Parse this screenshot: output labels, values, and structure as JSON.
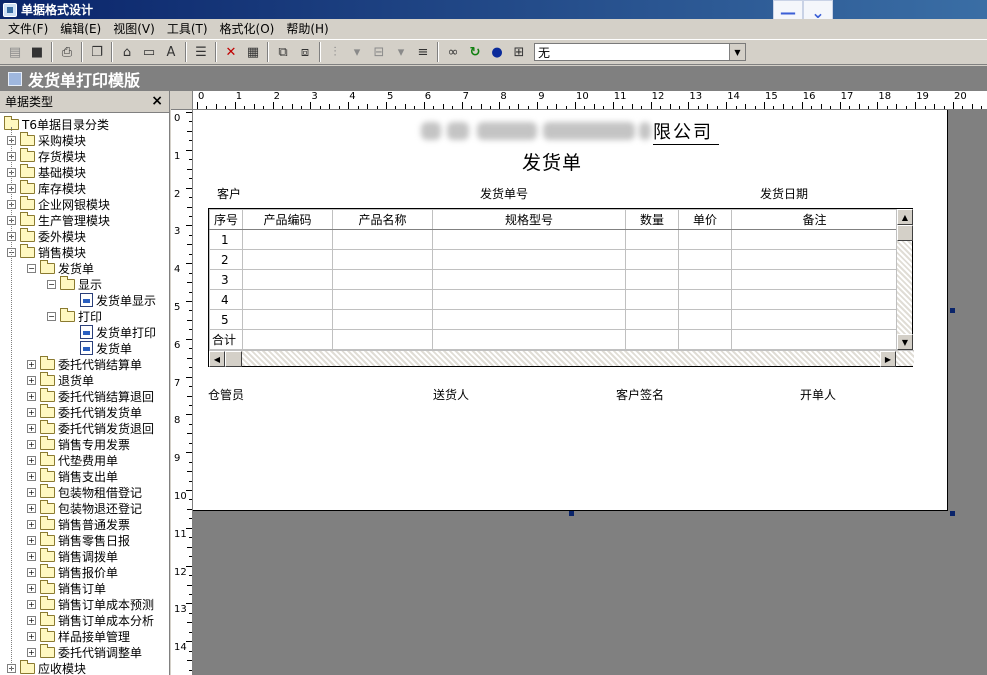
{
  "window": {
    "title": "单据格式设计"
  },
  "window_buttons": {
    "minimize": "—",
    "dropdown": "⌄"
  },
  "menu": [
    {
      "label": "文件(F)"
    },
    {
      "label": "编辑(E)"
    },
    {
      "label": "视图(V)"
    },
    {
      "label": "工具(T)"
    },
    {
      "label": "格式化(O)"
    },
    {
      "label": "帮助(H)"
    }
  ],
  "toolbar": {
    "font_glyph": "A",
    "style_combo_value": "无"
  },
  "document": {
    "title": "发货单打印模版"
  },
  "left_panel": {
    "title": "单据类型",
    "close_label": "×"
  },
  "tree": [
    {
      "label": "T6单据目录分类",
      "level": 0,
      "kind": "root"
    },
    {
      "label": "采购模块",
      "level": 1,
      "kind": "folder",
      "toggle": "+"
    },
    {
      "label": "存货模块",
      "level": 1,
      "kind": "folder",
      "toggle": "+"
    },
    {
      "label": "基础模块",
      "level": 1,
      "kind": "folder",
      "toggle": "+"
    },
    {
      "label": "库存模块",
      "level": 1,
      "kind": "folder",
      "toggle": "+"
    },
    {
      "label": "企业网银模块",
      "level": 1,
      "kind": "folder",
      "toggle": "+"
    },
    {
      "label": "生产管理模块",
      "level": 1,
      "kind": "folder",
      "toggle": "+"
    },
    {
      "label": "委外模块",
      "level": 1,
      "kind": "folder",
      "toggle": "+"
    },
    {
      "label": "销售模块",
      "level": 1,
      "kind": "folder",
      "toggle": "−"
    },
    {
      "label": "发货单",
      "level": 2,
      "kind": "folder",
      "toggle": "−"
    },
    {
      "label": "显示",
      "level": 3,
      "kind": "folder",
      "toggle": "−"
    },
    {
      "label": "发货单显示",
      "level": 4,
      "kind": "doc"
    },
    {
      "label": "打印",
      "level": 3,
      "kind": "folder",
      "toggle": "−"
    },
    {
      "label": "发货单打印",
      "level": 4,
      "kind": "doc"
    },
    {
      "label": "发货单",
      "level": 4,
      "kind": "doc"
    },
    {
      "label": "委托代销结算单",
      "level": 2,
      "kind": "folder",
      "toggle": "+"
    },
    {
      "label": "退货单",
      "level": 2,
      "kind": "folder",
      "toggle": "+"
    },
    {
      "label": "委托代销结算退回",
      "level": 2,
      "kind": "folder",
      "toggle": "+"
    },
    {
      "label": "委托代销发货单",
      "level": 2,
      "kind": "folder",
      "toggle": "+"
    },
    {
      "label": "委托代销发货退回",
      "level": 2,
      "kind": "folder",
      "toggle": "+"
    },
    {
      "label": "销售专用发票",
      "level": 2,
      "kind": "folder",
      "toggle": "+"
    },
    {
      "label": "代垫费用单",
      "level": 2,
      "kind": "folder",
      "toggle": "+"
    },
    {
      "label": "销售支出单",
      "level": 2,
      "kind": "folder",
      "toggle": "+"
    },
    {
      "label": "包装物租借登记",
      "level": 2,
      "kind": "folder",
      "toggle": "+"
    },
    {
      "label": "包装物退还登记",
      "level": 2,
      "kind": "folder",
      "toggle": "+"
    },
    {
      "label": "销售普通发票",
      "level": 2,
      "kind": "folder",
      "toggle": "+"
    },
    {
      "label": "销售零售日报",
      "level": 2,
      "kind": "folder",
      "toggle": "+"
    },
    {
      "label": "销售调拨单",
      "level": 2,
      "kind": "folder",
      "toggle": "+"
    },
    {
      "label": "销售报价单",
      "level": 2,
      "kind": "folder",
      "toggle": "+"
    },
    {
      "label": "销售订单",
      "level": 2,
      "kind": "folder",
      "toggle": "+"
    },
    {
      "label": "销售订单成本预测",
      "level": 2,
      "kind": "folder",
      "toggle": "+"
    },
    {
      "label": "销售订单成本分析",
      "level": 2,
      "kind": "folder",
      "toggle": "+"
    },
    {
      "label": "样品接单管理",
      "level": 2,
      "kind": "folder",
      "toggle": "+"
    },
    {
      "label": "委托代销调整单",
      "level": 2,
      "kind": "folder",
      "toggle": "+"
    },
    {
      "label": "应收模块",
      "level": 1,
      "kind": "folder",
      "toggle": "+"
    }
  ],
  "ruler_top": [
    "0",
    "1",
    "2",
    "3",
    "4",
    "5",
    "6",
    "7",
    "8",
    "9",
    "10",
    "11",
    "12",
    "13",
    "14",
    "15",
    "16",
    "17",
    "18",
    "19",
    "20"
  ],
  "ruler_left": [
    "0",
    "1",
    "2",
    "3",
    "4",
    "5",
    "6",
    "7",
    "8",
    "9",
    "10",
    "11",
    "12",
    "13",
    "14"
  ],
  "form": {
    "company_suffix": "限公司",
    "doc_name": "发货单",
    "header_fields": {
      "customer": "客户",
      "delivery_no": "发货单号",
      "delivery_date": "发货日期"
    },
    "columns": [
      "序号",
      "产品编码",
      "产品名称",
      "规格型号",
      "数量",
      "单价",
      "备注"
    ],
    "rows": [
      {
        "no": "1"
      },
      {
        "no": "2"
      },
      {
        "no": "3"
      },
      {
        "no": "4"
      },
      {
        "no": "5"
      }
    ],
    "total_label": "合计",
    "footer_fields": {
      "keeper": "仓管员",
      "deliverer": "送货人",
      "customer_sign": "客户签名",
      "issuer": "开单人"
    }
  },
  "scroll": {
    "up": "▲",
    "down": "▼",
    "left": "◀",
    "right": "▶"
  }
}
